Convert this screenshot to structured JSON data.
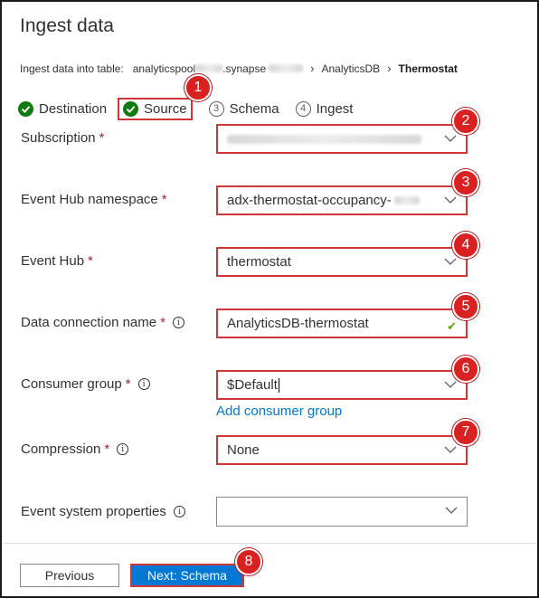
{
  "header": {
    "title": "Ingest data",
    "breadcrumb": {
      "label": "Ingest data into table:",
      "pool_prefix": "analyticspool",
      "workspace_mid": ".synapse",
      "database": "AnalyticsDB",
      "table": "Thermostat"
    }
  },
  "steps": [
    {
      "label": "Destination",
      "state": "done"
    },
    {
      "label": "Source",
      "state": "done"
    },
    {
      "label": "Schema",
      "number": "3"
    },
    {
      "label": "Ingest",
      "number": "4"
    }
  ],
  "form": {
    "subscription": {
      "label": "Subscription",
      "required": "*",
      "value": ""
    },
    "eventhub_namespace": {
      "label": "Event Hub namespace",
      "required": "*",
      "value": "adx-thermostat-occupancy-"
    },
    "eventhub": {
      "label": "Event Hub",
      "required": "*",
      "value": "thermostat"
    },
    "connection_name": {
      "label": "Data connection name",
      "required": "*",
      "value": "AnalyticsDB-thermostat"
    },
    "consumer_group": {
      "label": "Consumer group",
      "required": "*",
      "value": "$Default",
      "add_link": "Add consumer group"
    },
    "compression": {
      "label": "Compression",
      "required": "*",
      "value": "None"
    },
    "event_system_properties": {
      "label": "Event system properties",
      "value": ""
    }
  },
  "footer": {
    "previous_label": "Previous",
    "next_label": "Next: Schema"
  },
  "badges": [
    "1",
    "2",
    "3",
    "4",
    "5",
    "6",
    "7",
    "8"
  ],
  "colors": {
    "accent": "#0078d4",
    "success": "#107c10",
    "highlight": "#d23535",
    "badge": "#d92121"
  }
}
